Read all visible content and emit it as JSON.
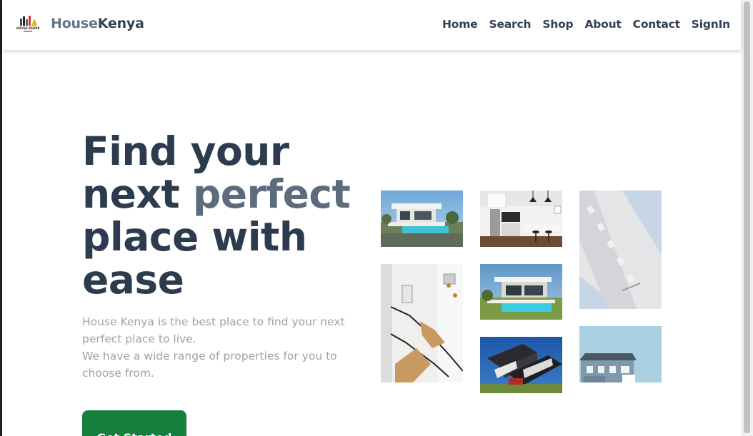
{
  "navbar": {
    "logo_alt": "House Kenya logo",
    "logo_text": "HOUSE KENYA",
    "brand_part1": "House",
    "brand_part2": "Kenya",
    "links": [
      "Home",
      "Search",
      "Shop",
      "About",
      "Contact",
      "SignIn"
    ]
  },
  "hero": {
    "title_line1": "Find your",
    "title_line2a": "next ",
    "title_line2b": "perfect",
    "title_line3": "place with",
    "title_line4": "ease",
    "description_line1": "House Kenya is the best place to find your next perfect place to live.",
    "description_line2": "We have a wide range of properties for you to choose from.",
    "cta_label": "Get Started"
  },
  "gallery": {
    "images": [
      "modern-villa-pool-photo",
      "modern-kitchen-photo",
      "white-building-facade-photo",
      "spiral-staircase-photo",
      "villa-pool-evening-photo",
      "angular-architecture-photo",
      "blue-house-photo"
    ]
  },
  "colors": {
    "brand_gray": "#64748b",
    "heading": "#2d3b4e",
    "accent_text": "#5d6b7e",
    "cta_green": "#15803d"
  }
}
